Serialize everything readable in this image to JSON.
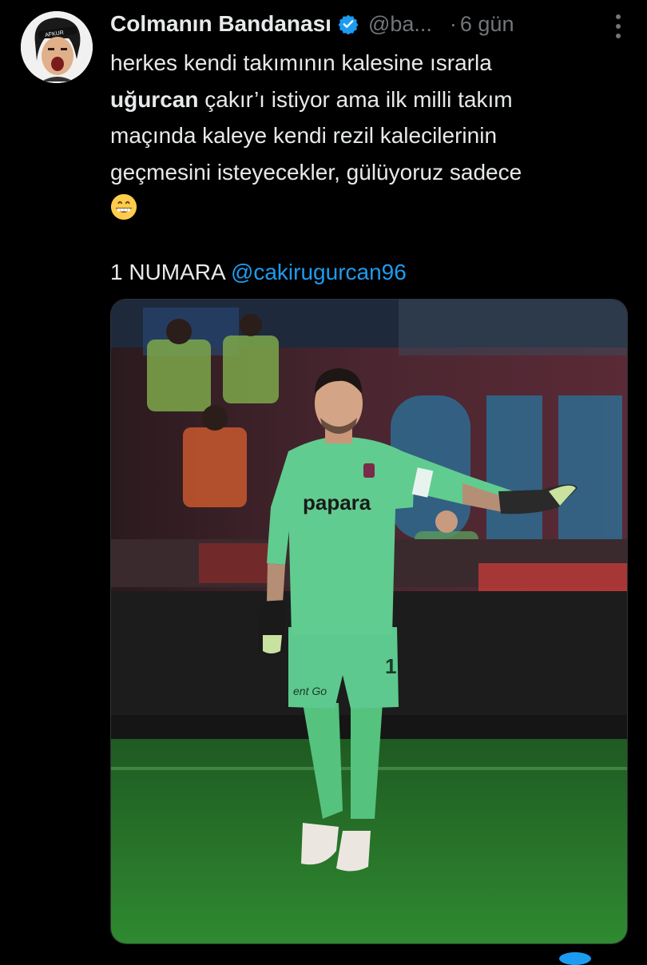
{
  "author": {
    "display_name": "Colmanın Bandanası",
    "handle": "@ba...",
    "time_separator": "·",
    "time": "6 gün",
    "avatar_caption": "AFKUR",
    "verified": true
  },
  "tweet": {
    "line1": "herkes kendi takımının kalesine ısrarla",
    "line2_bold": "uğurcan",
    "line2_rest": " çakır’ı istiyor ama ilk milli takım",
    "line3": "maçında kaleye kendi rezil kalecilerinin",
    "line4": "geçmesini isteyecekler, gülüyoruz sadece",
    "emoji": "grinning-face-icon",
    "caption_prefix": "1 NUMARA ",
    "mention": "@cakirugurcan96"
  },
  "media": {
    "sponsor_text": "papara",
    "shirt_number": "1",
    "shorts_text": "ent Go"
  },
  "colors": {
    "background": "#000000",
    "text": "#e7e9ea",
    "muted": "#71767b",
    "link": "#1d9bf0",
    "kit_green": "#5ec98e"
  }
}
